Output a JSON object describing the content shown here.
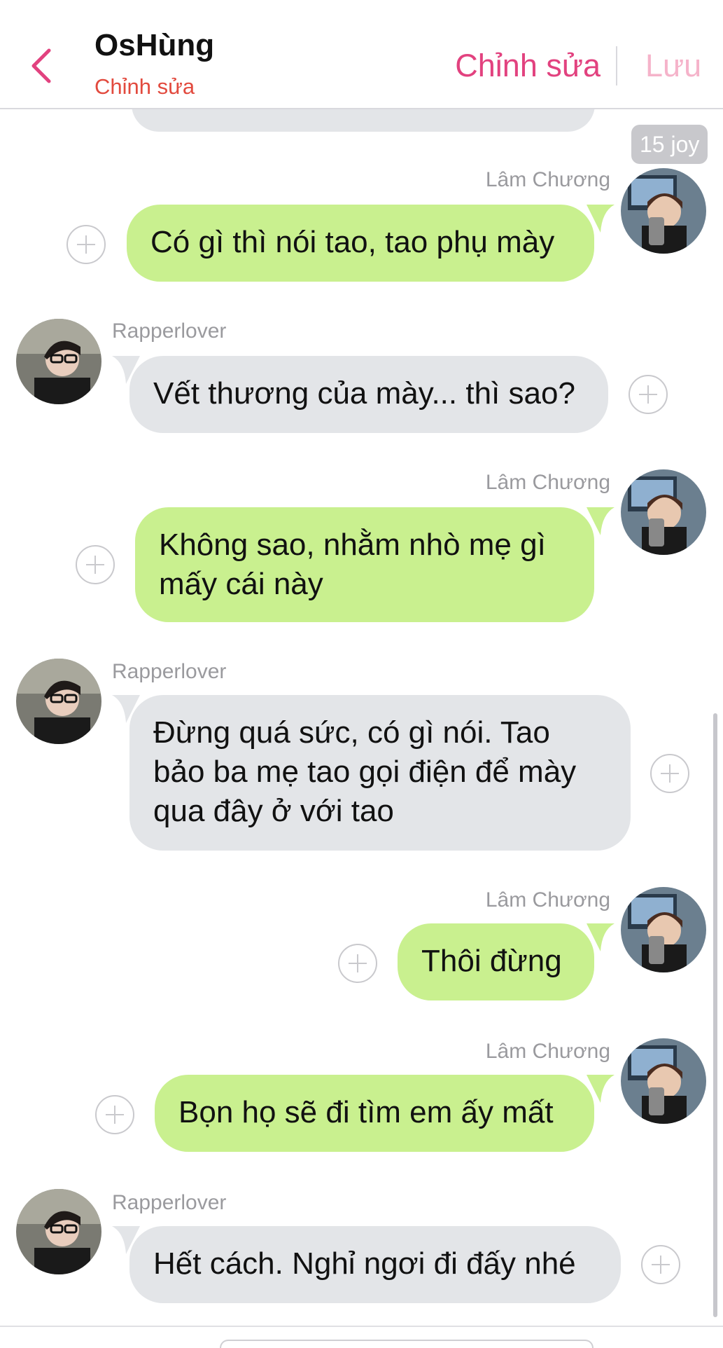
{
  "header": {
    "title": "OsHùng",
    "subtitle": "Chỉnh sửa",
    "edit_label": "Chỉnh sửa",
    "save_label": "Lưu",
    "accent": "#e2427f"
  },
  "time_badge": "15 joy",
  "senders": {
    "right": "Lâm Chương",
    "left": "Rapperlover"
  },
  "messages": [
    {
      "side": "right",
      "sender": "Lâm Chương",
      "text": "Có gì thì nói tao, tao phụ mày"
    },
    {
      "side": "left",
      "sender": "Rapperlover",
      "text": "Vết thương của mày... thì sao?"
    },
    {
      "side": "right",
      "sender": "Lâm Chương",
      "text": "Không sao, nhằm nhò mẹ gì mấy cái này"
    },
    {
      "side": "left",
      "sender": "Rapperlover",
      "text": "Đừng quá sức, có gì nói. Tao bảo ba mẹ tao gọi điện để mày qua đây ở với tao"
    },
    {
      "side": "right",
      "sender": "Lâm Chương",
      "text": "Thôi đừng"
    },
    {
      "side": "right",
      "sender": "Lâm Chương",
      "text": "Bọn họ sẽ đi tìm em ấy mất"
    },
    {
      "side": "left",
      "sender": "Rapperlover",
      "text": "Hết cách. Nghỉ ngơi đi đấy nhé"
    }
  ],
  "colors": {
    "outgoing_bubble": "#c9f08f",
    "incoming_bubble": "#e3e5e8"
  }
}
